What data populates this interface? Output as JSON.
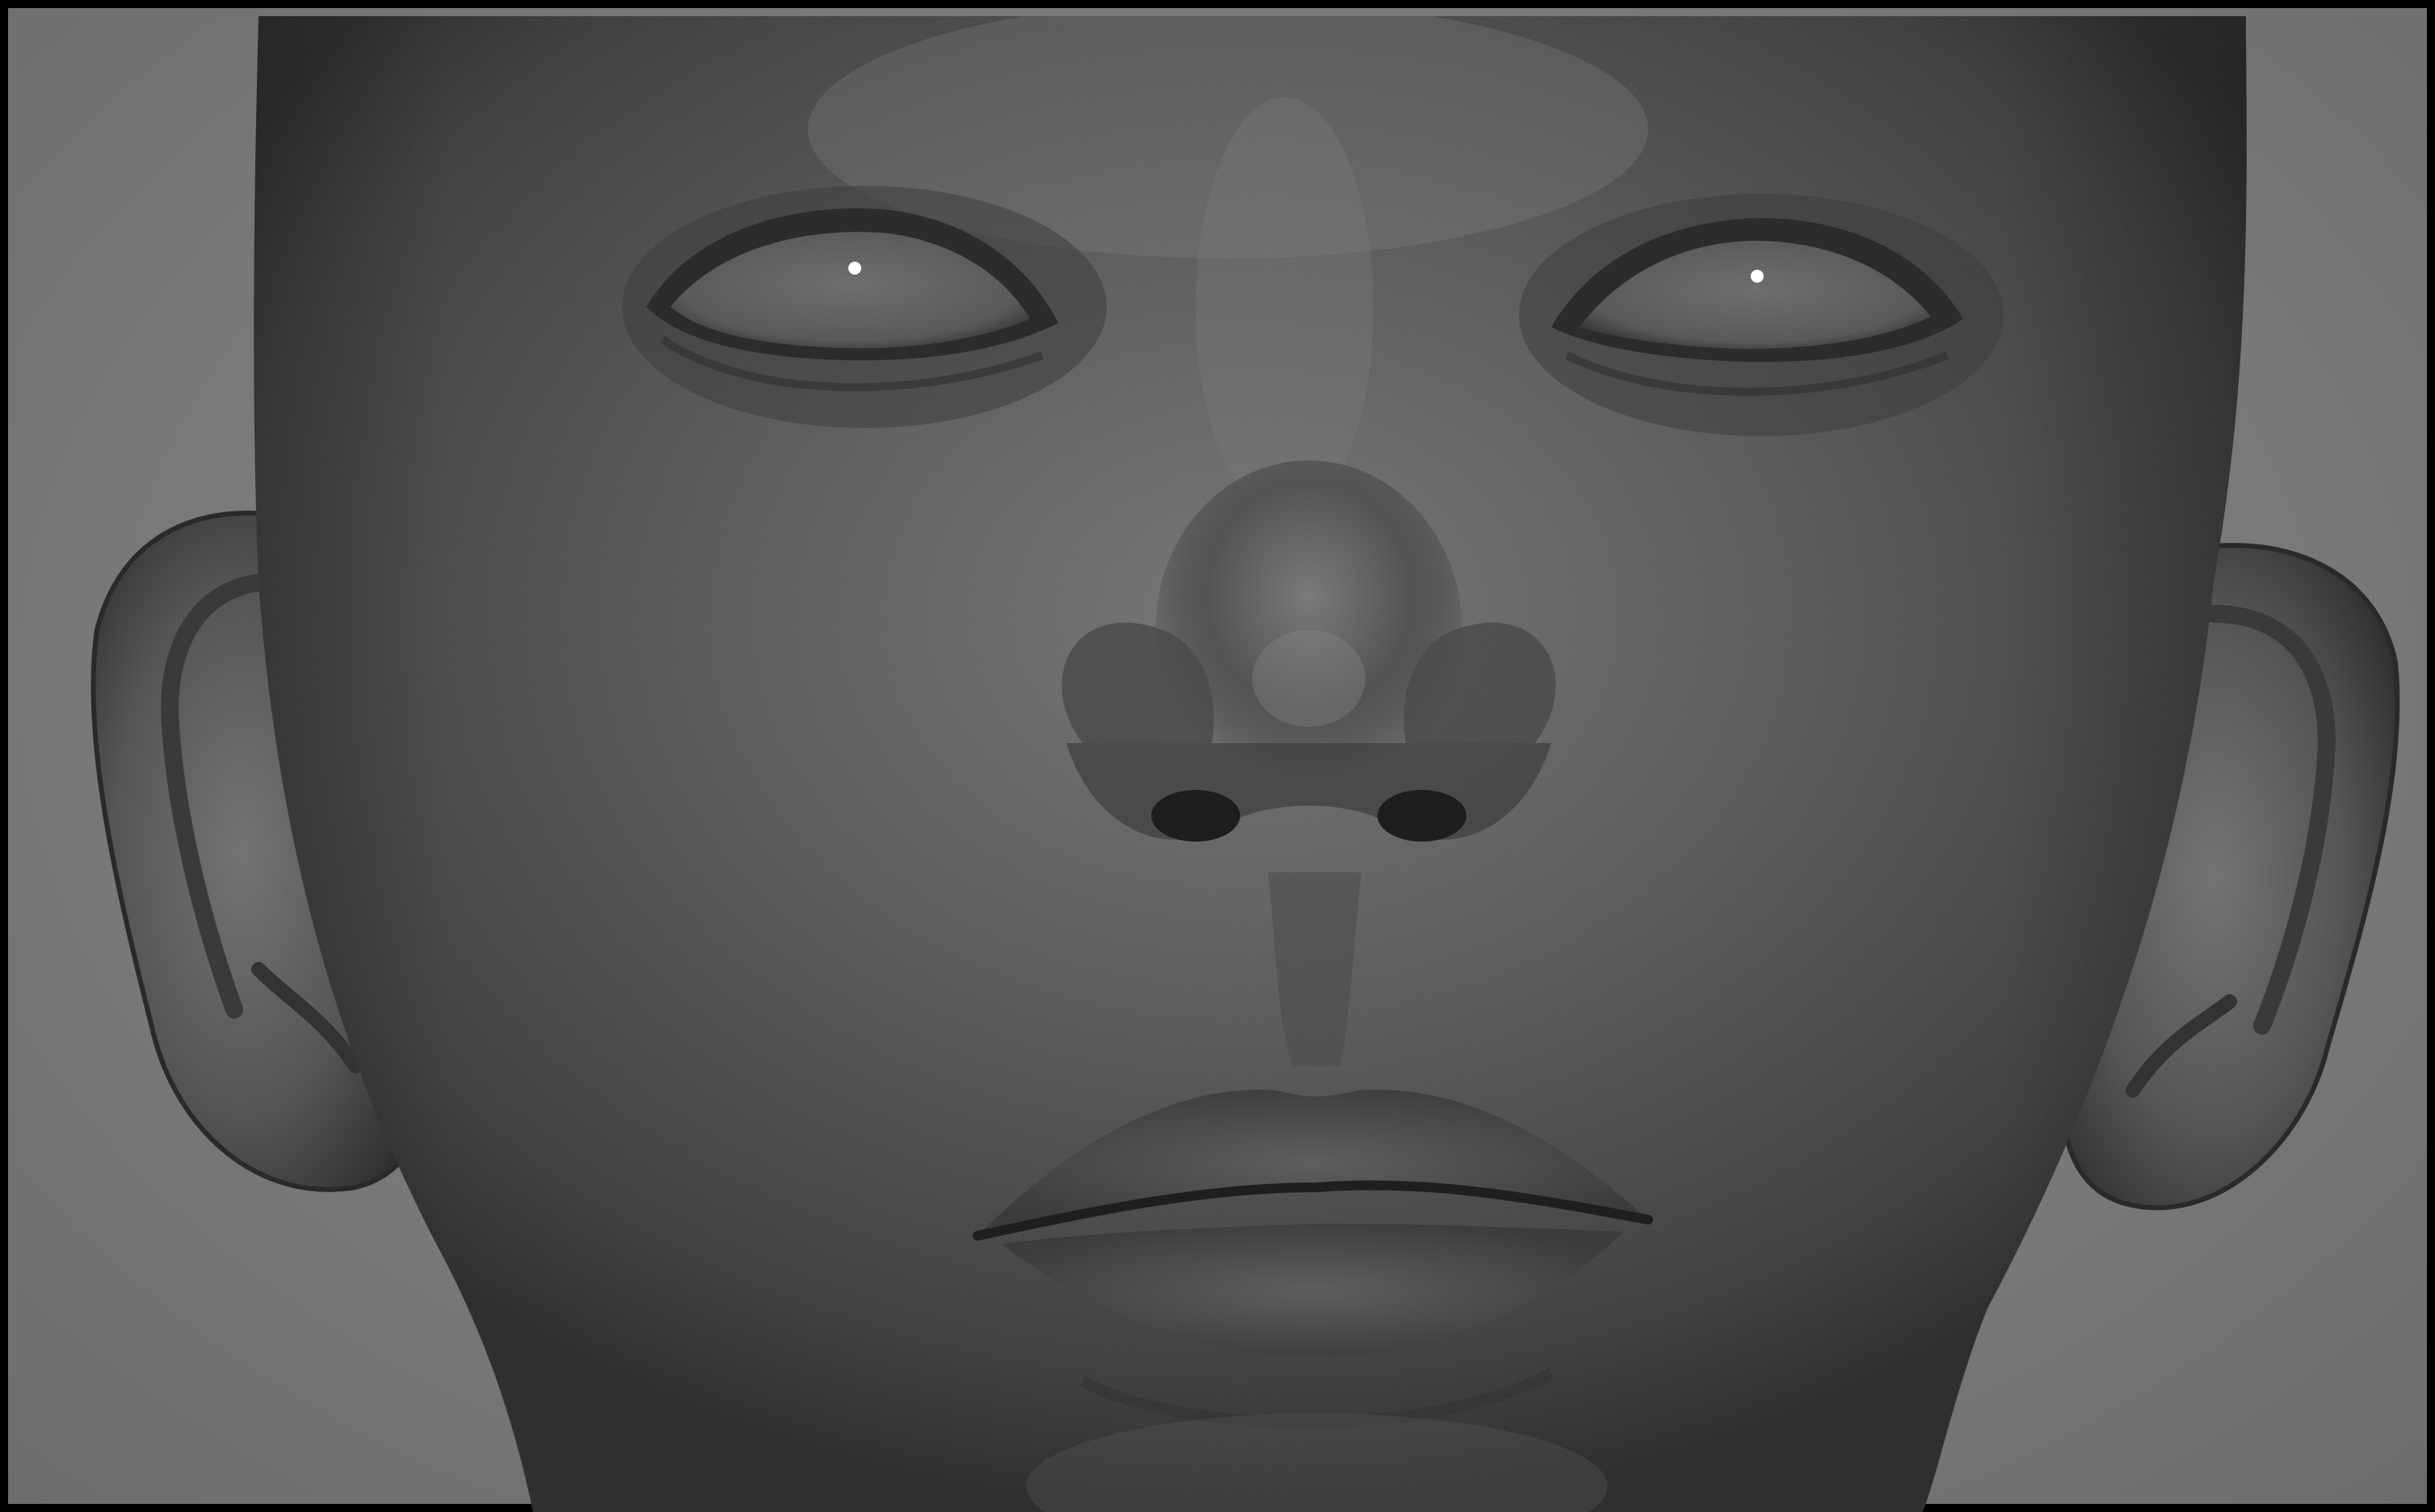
{
  "viewport": {
    "background_color": "#7d7d7d",
    "border_color": "#000000",
    "subject": "sculpt-head-icon"
  },
  "colors": {
    "skin_light": "#6e6e6e",
    "skin_mid": "#4a4a4a",
    "skin_dark": "#262626",
    "eye_glass": "#666666",
    "specular": "#ffffff"
  }
}
